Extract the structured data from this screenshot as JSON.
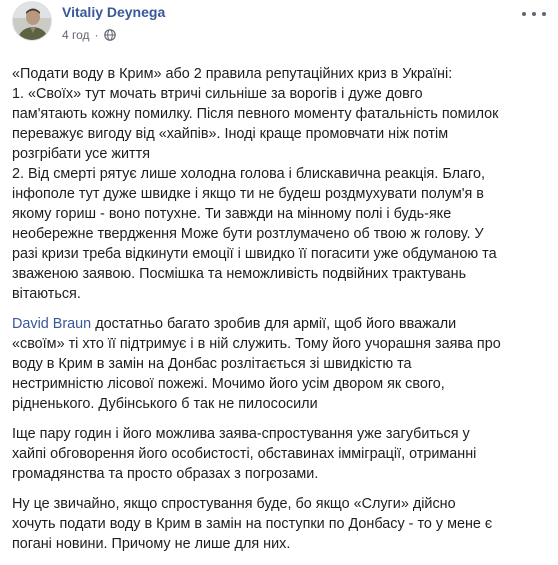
{
  "post": {
    "author": "Vitaliy Deynega",
    "time": "4 год",
    "separator": "·",
    "avatar_icon": "person-avatar",
    "privacy_icon": "globe-icon",
    "colors": {
      "link": "#385898",
      "text": "#1c1e21",
      "meta": "#616770"
    }
  },
  "body": {
    "p1": {
      "l1": "«Подати воду в Крим» або 2 правила репутаційних криз в Україні:",
      "l2": "1. «Своїх» тут мочать втричі сильніше за ворогів і дуже довго",
      "l3": "пам'ятають кожну помилку. Після певного моменту фатальність помилок",
      "l4": "переважує вигоду від «хайпів». Іноді краще промовчати ніж потім",
      "l5": "розгрібати усе життя",
      "l6": "2. Від смерті рятує лише холодна голова і блискавична реакція. Благо,",
      "l7": "інфополе тут дуже швидке і якщо ти не будеш роздмухувати полум'я в",
      "l8": "якому гориш - воно потухне. Ти завжди на мінному полі і будь-яке",
      "l9": "необережне твердження Може бути розтлумачено об твою ж голову. У",
      "l10": "разі кризи треба відкинути емоції і швидко її погасити уже обдуманою та",
      "l11": "зваженою заявою. Посмішка та неможливість подвійних трактувань",
      "l12": "вітаються."
    },
    "p2": {
      "mention": "David Braun",
      "l1_rest": " достатньо багато зробив для армії, щоб його вважали",
      "l2": "«своїм» ті хто її підтримує і в ній служить. Тому його учорашня заява про",
      "l3": "воду в Крим в замін на Донбас розлітається зі швидкістю та",
      "l4": "нестримністю лісової пожежі. Мочимо його усім двором як свого,",
      "l5": "рідненького. Дубінського б так не пилососили"
    },
    "p3": {
      "l1": "Іще пару годин і його можлива заява-спростування уже загубиться у",
      "l2": "хайпі обговорення його особистості, обставинах імміграції, отриманні",
      "l3": "громадянства та просто образах з погрозами."
    },
    "p4": {
      "l1": "Ну це звичайно, якщо спростування буде, бо якщо «Слуги» дійсно",
      "l2": "хочуть подати воду в Крим в замін на поступки по Донбасу - то у мене є",
      "l3": "погані новини. Причому не лише для них."
    }
  }
}
